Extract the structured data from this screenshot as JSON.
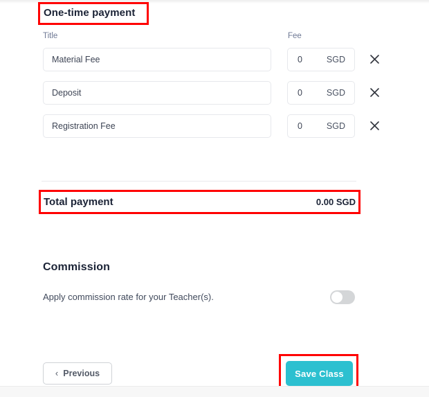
{
  "sections": {
    "one_time_payment": {
      "heading": "One-time payment",
      "column_headers": {
        "title": "Title",
        "fee": "Fee"
      },
      "rows": [
        {
          "title": "Material Fee",
          "fee": "0",
          "currency": "SGD",
          "remove_icon": "close-icon"
        },
        {
          "title": "Deposit",
          "fee": "0",
          "currency": "SGD",
          "remove_icon": "close-icon"
        },
        {
          "title": "Registration Fee",
          "fee": "0",
          "currency": "SGD",
          "remove_icon": "close-icon"
        }
      ],
      "total": {
        "label": "Total payment",
        "value": "0.00 SGD"
      }
    },
    "commission": {
      "heading": "Commission",
      "description": "Apply commission rate for your Teacher(s).",
      "toggle_state": "off"
    }
  },
  "footer": {
    "previous_label": "Previous",
    "previous_icon": "chevron-left-icon",
    "save_label": "Save Class"
  },
  "colors": {
    "accent_teal": "#2cc0d0",
    "annotation_red": "#ff0000",
    "heading_text": "#1b2336",
    "muted_text": "#6e7894",
    "input_border": "#e6e8ec",
    "toggle_off": "#d4d6d8"
  },
  "annotations": [
    {
      "name": "one-time-payment-highlight",
      "target": "One-time payment"
    },
    {
      "name": "total-payment-highlight",
      "target": "Total payment"
    },
    {
      "name": "save-class-highlight",
      "target": "Save Class"
    }
  ]
}
